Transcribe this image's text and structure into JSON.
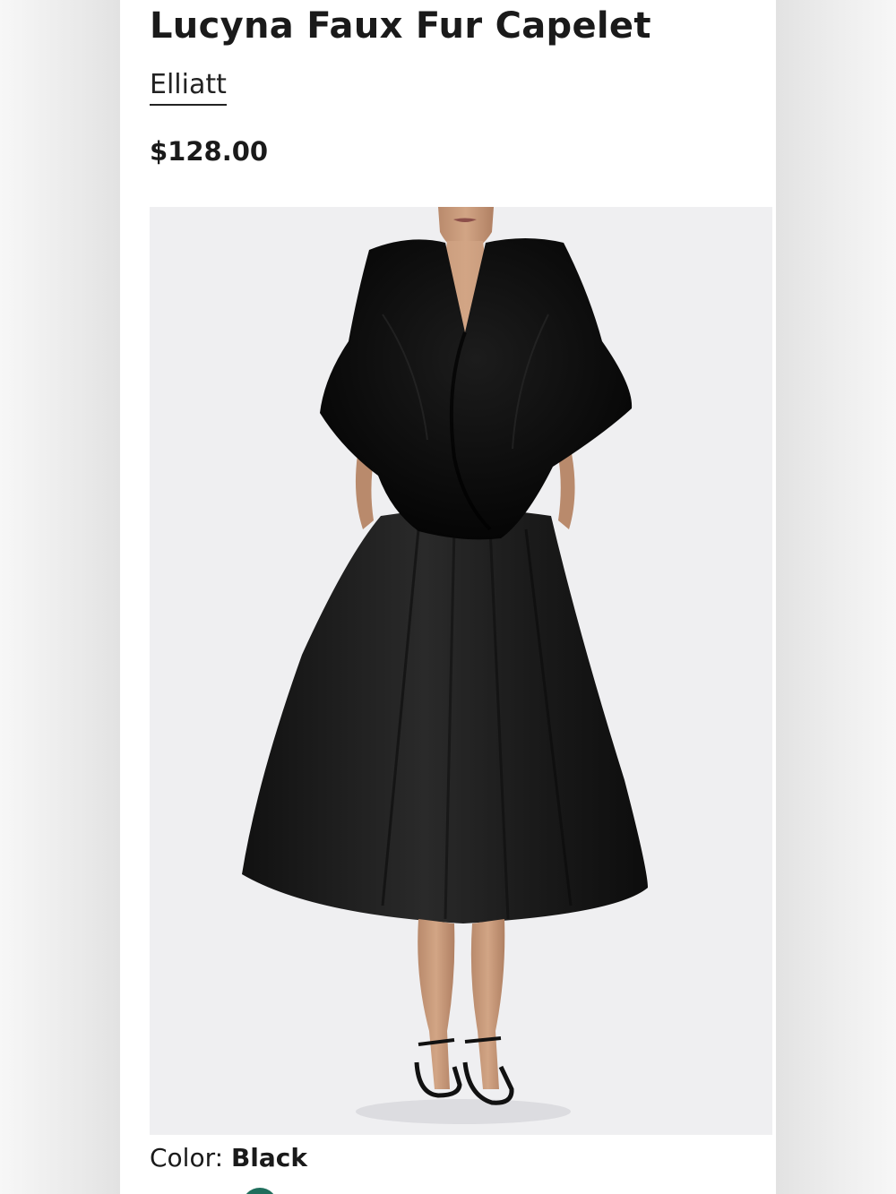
{
  "product": {
    "title": "Lucyna Faux Fur Capelet",
    "brand": "Elliatt",
    "price": "$128.00",
    "image_alt": "Model wearing black faux fur capelet over black midi dress"
  },
  "color": {
    "label": "Color: ",
    "value": "Black"
  },
  "colors": {
    "background": "#ffffff",
    "text": "#1a1a1a",
    "photo_bg": "#efeff1"
  }
}
